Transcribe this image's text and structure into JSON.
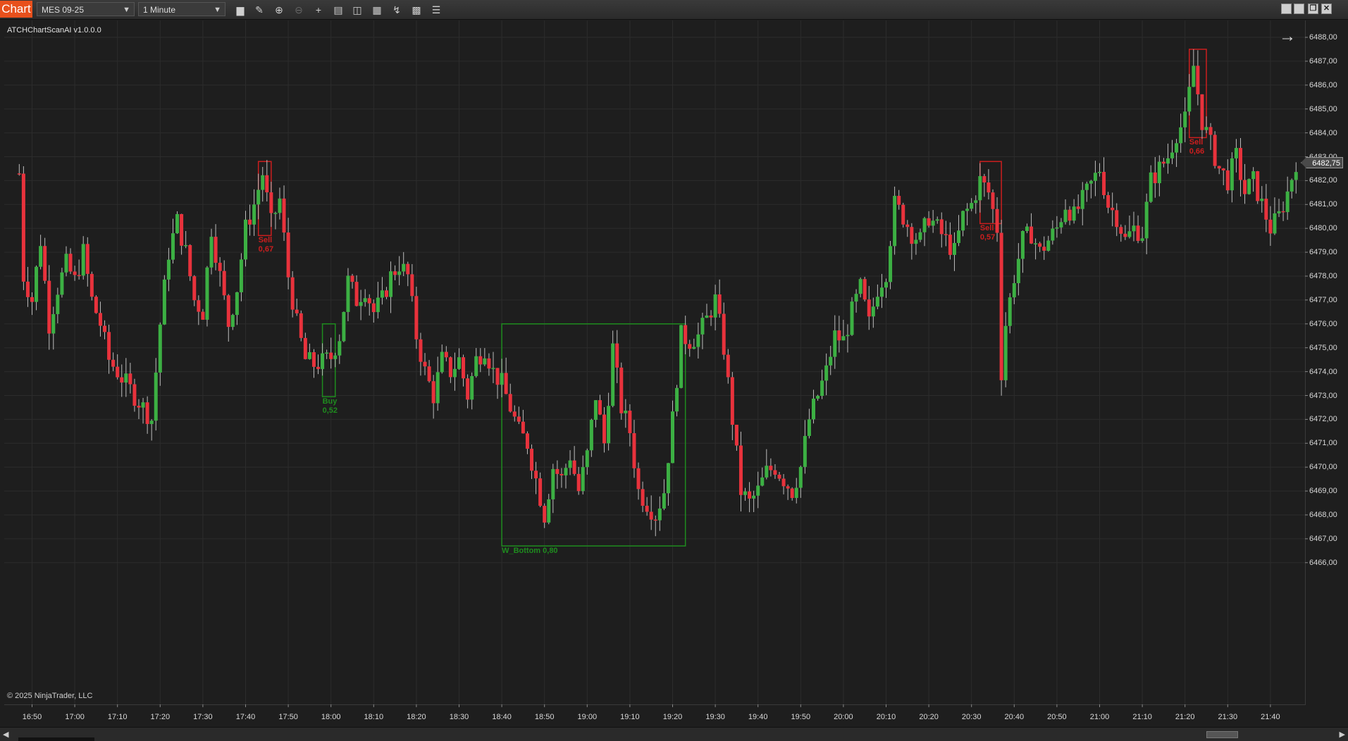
{
  "toolbar": {
    "chart_tab": "Chart",
    "instrument": "MES 09-25",
    "interval": "1 Minute",
    "icons": [
      "bar-type-icon",
      "draw-pencil-icon",
      "zoom-in-icon",
      "zoom-out-icon",
      "crosshair-icon",
      "data-box-icon",
      "properties-icon",
      "strategies-icon",
      "indicators-icon",
      "templates-icon",
      "list-icon"
    ],
    "window_icons": [
      "tile-icon",
      "minimize-icon",
      "restore-icon",
      "close-icon"
    ]
  },
  "indicator_label": "ATCHChartScanAI v1.0.0.0",
  "copyright": "© 2025 NinjaTrader, LLC",
  "current_price": "6482,75",
  "colors": {
    "up": "#3cb043",
    "down": "#e8323c",
    "buy_box": "#1e8c1e",
    "sell_box": "#cc1e1e",
    "background": "#1e1e1e"
  },
  "patterns": [
    {
      "type": "sell",
      "label": "Sell",
      "score": "0,67"
    },
    {
      "type": "buy",
      "label": "Buy",
      "score": "0,52"
    },
    {
      "type": "buy",
      "label": "W_Bottom 0,80",
      "score": ""
    },
    {
      "type": "sell",
      "label": "Sell",
      "score": "0,57"
    },
    {
      "type": "sell",
      "label": "Sell",
      "score": "0,66"
    }
  ],
  "chart_data": {
    "type": "candlestick",
    "instrument": "MES 09-25",
    "interval": "1 Minute",
    "y_ticks": [
      "6488,00",
      "6487,00",
      "6486,00",
      "6485,00",
      "6484,00",
      "6483,00",
      "6482,00",
      "6481,00",
      "6480,00",
      "6479,00",
      "6478,00",
      "6477,00",
      "6476,00",
      "6475,00",
      "6474,00",
      "6473,00",
      "6472,00",
      "6471,00",
      "6470,00",
      "6469,00",
      "6468,00",
      "6467,00",
      "6466,00"
    ],
    "x_ticks": [
      "16:50",
      "17:00",
      "17:10",
      "17:20",
      "17:30",
      "17:40",
      "17:50",
      "18:00",
      "18:10",
      "18:20",
      "18:30",
      "18:40",
      "18:50",
      "19:00",
      "19:10",
      "19:20",
      "19:30",
      "19:40",
      "19:50",
      "20:00",
      "20:10",
      "20:20",
      "20:30",
      "20:40",
      "20:50",
      "21:00",
      "21:10",
      "21:20",
      "21:30",
      "21:40"
    ],
    "ylim": [
      6465.6,
      6488.4
    ],
    "path_points": [
      [
        "16:47",
        6482.3
      ],
      [
        "16:48",
        6478
      ],
      [
        "16:50",
        6477
      ],
      [
        "16:52",
        6479.5
      ],
      [
        "16:54",
        6476
      ],
      [
        "16:56",
        6477.5
      ],
      [
        "16:58",
        6478.5
      ],
      [
        "17:00",
        6477.8
      ],
      [
        "17:02",
        6479
      ],
      [
        "17:04",
        6477
      ],
      [
        "17:06",
        6476
      ],
      [
        "17:08",
        6474.5
      ],
      [
        "17:10",
        6474
      ],
      [
        "17:12",
        6473.5
      ],
      [
        "17:14",
        6473
      ],
      [
        "17:16",
        6472.5
      ],
      [
        "17:18",
        6472
      ],
      [
        "17:20",
        6476
      ],
      [
        "17:22",
        6479
      ],
      [
        "17:24",
        6480.3
      ],
      [
        "17:26",
        6479
      ],
      [
        "17:28",
        6477
      ],
      [
        "17:30",
        6476.5
      ],
      [
        "17:32",
        6480
      ],
      [
        "17:34",
        6478
      ],
      [
        "17:36",
        6476
      ],
      [
        "17:38",
        6477.5
      ],
      [
        "17:40",
        6480
      ],
      [
        "17:42",
        6481
      ],
      [
        "17:44",
        6482.3
      ],
      [
        "17:46",
        6480.2
      ],
      [
        "17:48",
        6481.2
      ],
      [
        "17:50",
        6478
      ],
      [
        "17:52",
        6476
      ],
      [
        "17:54",
        6474.5
      ],
      [
        "17:56",
        6474.3
      ],
      [
        "17:58",
        6474.4
      ],
      [
        "18:00",
        6474.6
      ],
      [
        "18:02",
        6475.5
      ],
      [
        "18:04",
        6477.8
      ],
      [
        "18:06",
        6477
      ],
      [
        "18:08",
        6477.5
      ],
      [
        "18:10",
        6476.5
      ],
      [
        "18:12",
        6477
      ],
      [
        "18:14",
        6478
      ],
      [
        "18:16",
        6478.5
      ],
      [
        "18:18",
        6478
      ],
      [
        "18:20",
        6475.5
      ],
      [
        "18:22",
        6474
      ],
      [
        "18:24",
        6473
      ],
      [
        "18:26",
        6474.5
      ],
      [
        "18:28",
        6474
      ],
      [
        "18:30",
        6474.5
      ],
      [
        "18:32",
        6473
      ],
      [
        "18:34",
        6474.5
      ],
      [
        "18:36",
        6475
      ],
      [
        "18:38",
        6474
      ],
      [
        "18:40",
        6473.5
      ],
      [
        "18:42",
        6472.5
      ],
      [
        "18:44",
        6471.5
      ],
      [
        "18:46",
        6471
      ],
      [
        "18:48",
        6469.5
      ],
      [
        "18:50",
        6468
      ],
      [
        "18:52",
        6470
      ],
      [
        "18:54",
        6469.5
      ],
      [
        "18:56",
        6470.5
      ],
      [
        "18:58",
        6469
      ],
      [
        "19:00",
        6470.5
      ],
      [
        "19:02",
        6473
      ],
      [
        "19:04",
        6471
      ],
      [
        "19:06",
        6475
      ],
      [
        "19:08",
        6472.5
      ],
      [
        "19:10",
        6471.5
      ],
      [
        "19:12",
        6469
      ],
      [
        "19:14",
        6468.5
      ],
      [
        "19:16",
        6468
      ],
      [
        "19:18",
        6469
      ],
      [
        "19:20",
        6472
      ],
      [
        "19:22",
        6475.5
      ],
      [
        "19:24",
        6475.3
      ],
      [
        "19:26",
        6475.5
      ],
      [
        "19:28",
        6476.2
      ],
      [
        "19:30",
        6477
      ],
      [
        "19:32",
        6475
      ],
      [
        "19:34",
        6472
      ],
      [
        "19:36",
        6469
      ],
      [
        "19:38",
        6468.5
      ],
      [
        "19:40",
        6469
      ],
      [
        "19:42",
        6469.8
      ],
      [
        "19:44",
        6470
      ],
      [
        "19:46",
        6469.5
      ],
      [
        "19:48",
        6469
      ],
      [
        "19:50",
        6470
      ],
      [
        "19:52",
        6472
      ],
      [
        "19:54",
        6473
      ],
      [
        "19:56",
        6474
      ],
      [
        "19:58",
        6475.5
      ],
      [
        "20:00",
        6475.3
      ],
      [
        "20:02",
        6476.5
      ],
      [
        "20:04",
        6477.5
      ],
      [
        "20:06",
        6476
      ],
      [
        "20:08",
        6477.5
      ],
      [
        "20:10",
        6478.2
      ],
      [
        "20:12",
        6481
      ],
      [
        "20:14",
        6480.5
      ],
      [
        "20:16",
        6479.8
      ],
      [
        "20:18",
        6479.5
      ],
      [
        "20:20",
        6480.5
      ],
      [
        "20:22",
        6480
      ],
      [
        "20:24",
        6479.5
      ],
      [
        "20:26",
        6479
      ],
      [
        "20:28",
        6480.5
      ],
      [
        "20:30",
        6481
      ],
      [
        "20:32",
        6482
      ],
      [
        "20:34",
        6481.5
      ],
      [
        "20:36",
        6480
      ],
      [
        "20:37",
        6474
      ],
      [
        "20:38",
        6476
      ],
      [
        "20:40",
        6478
      ],
      [
        "20:42",
        6479.5
      ],
      [
        "20:44",
        6479.8
      ],
      [
        "20:46",
        6479
      ],
      [
        "20:48",
        6479.5
      ],
      [
        "20:50",
        6480
      ],
      [
        "20:52",
        6481
      ],
      [
        "20:54",
        6480.5
      ],
      [
        "21:00",
        6482.5
      ],
      [
        "21:02",
        6481
      ],
      [
        "21:04",
        6480.5
      ],
      [
        "21:06",
        6479.5
      ],
      [
        "21:08",
        6480
      ],
      [
        "21:10",
        6479.8
      ],
      [
        "21:12",
        6482
      ],
      [
        "21:14",
        6482.5
      ],
      [
        "21:16",
        6483
      ],
      [
        "21:18",
        6484
      ],
      [
        "21:20",
        6484.5
      ],
      [
        "21:22",
        6486.8
      ],
      [
        "21:24",
        6484.5
      ],
      [
        "21:26",
        6483.5
      ],
      [
        "21:28",
        6482.5
      ],
      [
        "21:30",
        6482
      ],
      [
        "21:32",
        6483
      ],
      [
        "21:34",
        6481.5
      ],
      [
        "21:36",
        6482
      ],
      [
        "21:38",
        6481
      ],
      [
        "21:40",
        6480
      ],
      [
        "21:42",
        6480.5
      ],
      [
        "21:44",
        6481.5
      ],
      [
        "21:46",
        6482.8
      ]
    ]
  }
}
